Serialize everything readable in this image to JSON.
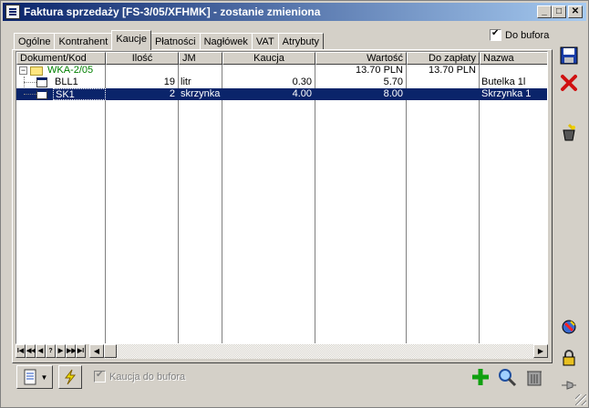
{
  "window": {
    "title": "Faktura sprzedaży [FS-3/05/XFHMK]  - zostanie zmieniona"
  },
  "tabs": [
    {
      "label": "Ogólne"
    },
    {
      "label": "Kontrahent"
    },
    {
      "label": "Kaucje",
      "active": true
    },
    {
      "label": "Płatności"
    },
    {
      "label": "Nagłówek"
    },
    {
      "label": "VAT"
    },
    {
      "label": "Atrybuty"
    }
  ],
  "do_bufora": {
    "label": "Do bufora",
    "checked": true
  },
  "grid": {
    "columns": [
      "Dokument/Kod",
      "Ilość",
      "JM",
      "Kaucja",
      "Wartość",
      "Do zapłaty",
      "Nazwa"
    ],
    "rows": [
      {
        "kod": "WKA-2/05",
        "ilosc": "",
        "jm": "",
        "kaucja": "",
        "wartosc": "13.70 PLN",
        "do_zaplaty": "13.70 PLN",
        "nazwa": "",
        "level": 0,
        "selected": false
      },
      {
        "kod": "BLL1",
        "ilosc": "19",
        "jm": "litr",
        "kaucja": "0.30",
        "wartosc": "5.70",
        "do_zaplaty": "",
        "nazwa": "Butelka 1l",
        "level": 1,
        "selected": false
      },
      {
        "kod": "SK1",
        "ilosc": "2",
        "jm": "skrzynka",
        "kaucja": "4.00",
        "wartosc": "8.00",
        "do_zaplaty": "",
        "nazwa": "Skrzynka 1",
        "level": 1,
        "selected": true
      }
    ]
  },
  "kaucja_do_bufora": {
    "label": "Kaucja do bufora",
    "checked": true,
    "disabled": true
  },
  "nav_buttons": [
    "I◀",
    "◀◀",
    "◀",
    "?",
    "▶",
    "▶▶",
    "▶I"
  ],
  "colors": {
    "title_start": "#0a246a",
    "title_end": "#a6caf0",
    "selection": "#0a246a",
    "tree_text": "#008000"
  }
}
